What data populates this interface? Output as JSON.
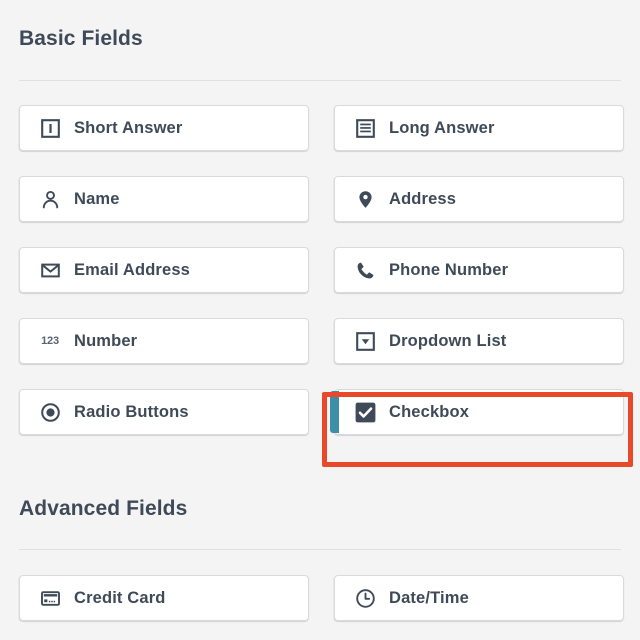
{
  "theme": {
    "background": "#f4f4f4",
    "button_background": "#ffffff",
    "button_border": "#d9dadb",
    "text": "#3f4a59",
    "divider": "#e0e0e0",
    "accent_teal": "#3e8ea8",
    "highlight_red": "#e8492b"
  },
  "sections": [
    {
      "title": "Basic Fields",
      "fields": [
        {
          "label": "Short Answer",
          "icon": "text-field-icon"
        },
        {
          "label": "Long Answer",
          "icon": "paragraph-icon"
        },
        {
          "label": "Name",
          "icon": "person-icon"
        },
        {
          "label": "Address",
          "icon": "map-pin-icon"
        },
        {
          "label": "Email Address",
          "icon": "envelope-icon"
        },
        {
          "label": "Phone Number",
          "icon": "phone-icon"
        },
        {
          "label": "Number",
          "icon": "number-123-icon"
        },
        {
          "label": "Dropdown List",
          "icon": "dropdown-caret-icon"
        },
        {
          "label": "Radio Buttons",
          "icon": "radio-button-icon"
        },
        {
          "label": "Checkbox",
          "icon": "checkbox-checked-icon",
          "selected": true,
          "highlighted": true
        }
      ]
    },
    {
      "title": "Advanced Fields",
      "fields": [
        {
          "label": "Credit Card",
          "icon": "credit-card-icon"
        },
        {
          "label": "Date/Time",
          "icon": "clock-icon"
        }
      ]
    }
  ],
  "icon_glyphs": {
    "number_123": "123"
  }
}
